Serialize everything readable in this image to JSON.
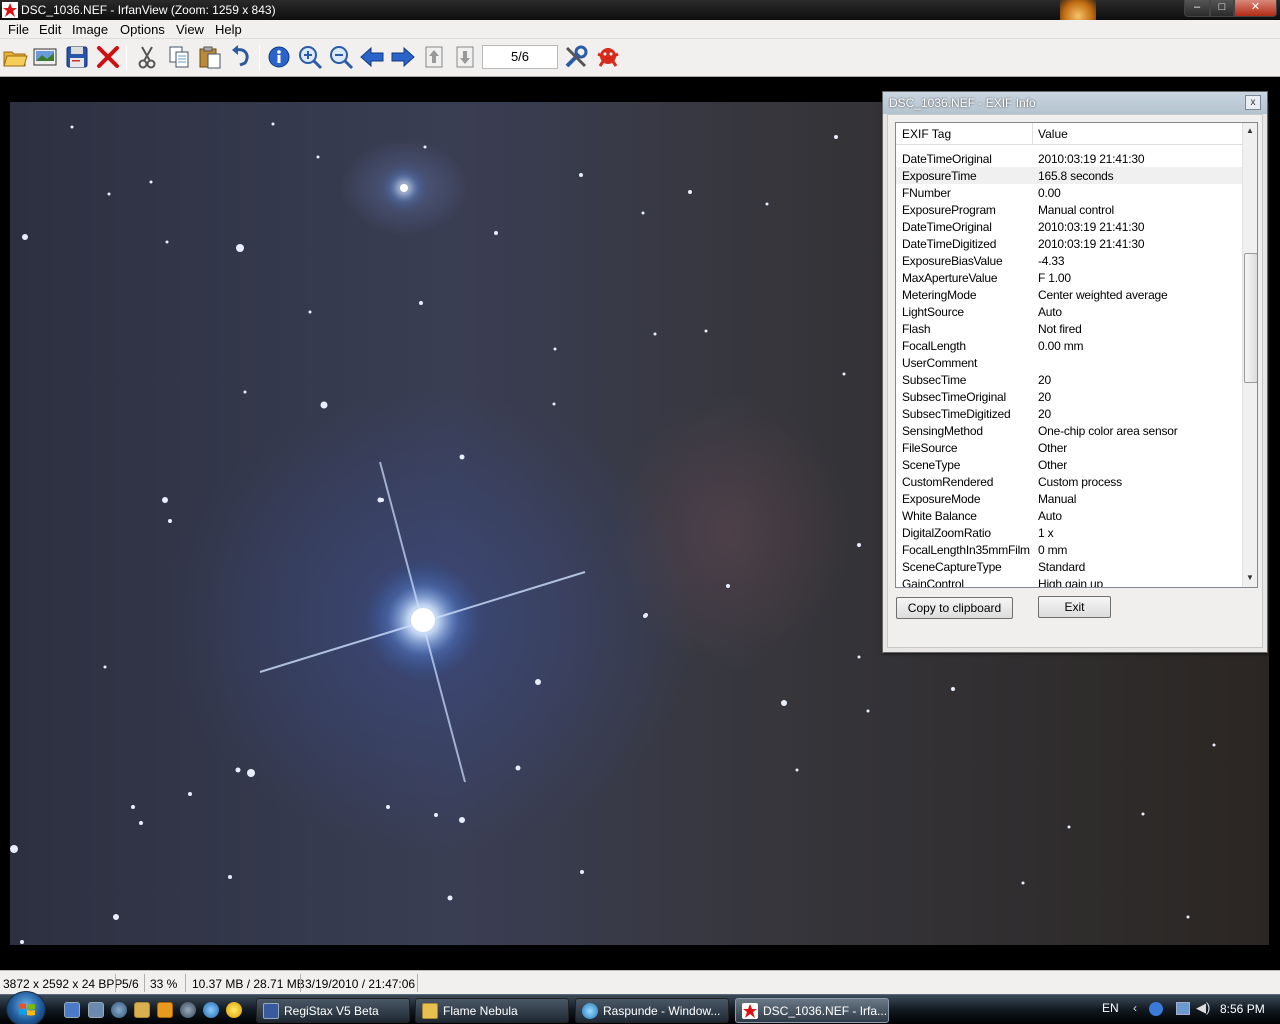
{
  "window": {
    "title": "DSC_1036.NEF - IrfanView (Zoom: 1259 x 843)",
    "controls": {
      "minimize": "–",
      "maximize": "□",
      "close": "✕"
    }
  },
  "menu": [
    "File",
    "Edit",
    "Image",
    "Options",
    "View",
    "Help"
  ],
  "toolbar": {
    "page_indicator": "5/6",
    "icons": [
      "open-folder-icon",
      "thumbnails-icon",
      "save-icon",
      "delete-icon",
      "cut-icon",
      "copy-icon",
      "paste-icon",
      "undo-icon",
      "info-icon",
      "zoom-in-icon",
      "zoom-out-icon",
      "previous-icon",
      "next-icon",
      "first-page-icon",
      "last-page-icon",
      "settings-icon",
      "exit-icon"
    ]
  },
  "exif_dialog": {
    "title": "DSC_1036.NEF - EXIF Info",
    "close": "x",
    "columns": [
      "EXIF Tag",
      "Value"
    ],
    "selected_row": 1,
    "rows": [
      [
        "DateTimeOriginal",
        "2010:03:19 21:41:30"
      ],
      [
        "ExposureTime",
        "165.8 seconds"
      ],
      [
        "FNumber",
        "0.00"
      ],
      [
        "ExposureProgram",
        "Manual control"
      ],
      [
        "DateTimeOriginal",
        "2010:03:19 21:41:30"
      ],
      [
        "DateTimeDigitized",
        "2010:03:19 21:41:30"
      ],
      [
        "ExposureBiasValue",
        "-4.33"
      ],
      [
        "MaxApertureValue",
        "F 1.00"
      ],
      [
        "MeteringMode",
        "Center weighted average"
      ],
      [
        "LightSource",
        "Auto"
      ],
      [
        "Flash",
        "Not fired"
      ],
      [
        "FocalLength",
        "0.00 mm"
      ],
      [
        "UserComment",
        ""
      ],
      [
        "SubsecTime",
        "20"
      ],
      [
        "SubsecTimeOriginal",
        "20"
      ],
      [
        "SubsecTimeDigitized",
        "20"
      ],
      [
        "SensingMethod",
        "One-chip color area sensor"
      ],
      [
        "FileSource",
        "Other"
      ],
      [
        "SceneType",
        "Other"
      ],
      [
        "CustomRendered",
        "Custom process"
      ],
      [
        "ExposureMode",
        "Manual"
      ],
      [
        "White Balance",
        "Auto"
      ],
      [
        "DigitalZoomRatio",
        "1 x"
      ],
      [
        "FocalLengthIn35mmFilm",
        "0 mm"
      ],
      [
        "SceneCaptureType",
        "Standard"
      ],
      [
        "GainControl",
        "High gain up"
      ]
    ],
    "buttons": {
      "copy": "Copy to clipboard",
      "exit": "Exit"
    }
  },
  "status": {
    "dimensions": "3872 x 2592 x 24 BPP",
    "page": "5/6",
    "zoom": "33 %",
    "size": "10.37 MB / 28.71 MB",
    "datetime": "3/19/2010 / 21:47:06"
  },
  "taskbar": {
    "tasks": [
      {
        "label": "RegiStax V5 Beta",
        "icon": "registax-icon"
      },
      {
        "label": "Flame Nebula",
        "icon": "folder-icon"
      },
      {
        "label": "Raspunde - Window...",
        "icon": "ie-icon"
      },
      {
        "label": "DSC_1036.NEF - Irfa...",
        "icon": "irfanview-icon"
      }
    ],
    "active_task": 3,
    "language": "EN",
    "clock": "8:56 PM"
  }
}
